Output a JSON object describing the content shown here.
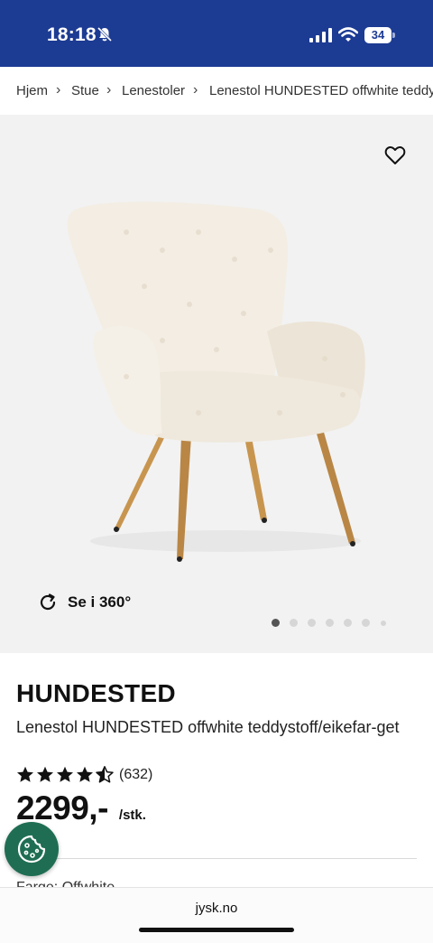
{
  "status_bar": {
    "time": "18:18",
    "battery": "34",
    "icons": [
      "bell-slash-icon",
      "signal-icon",
      "wifi-icon",
      "battery-icon"
    ]
  },
  "breadcrumb": {
    "items": [
      "Hjem",
      "Stue",
      "Lenestoler",
      "Lenestol HUNDESTED offwhite teddystoff/eikefarget"
    ],
    "separator": "›"
  },
  "gallery": {
    "view_360_label": "Se i 360°",
    "favorite_icon": "heart-icon",
    "image_count": 7,
    "active_image_index": 0
  },
  "product": {
    "brand": "HUNDESTED",
    "title": "Lenestol HUNDESTED offwhite teddystoff/eikefar-get",
    "rating_value": 4.5,
    "rating_count": "(632)",
    "price": "2299,-",
    "unit": "/stk."
  },
  "below_fold": {
    "partial_text": "Farge: Offwhite"
  },
  "cookie_button": {
    "icon": "cookie-icon"
  },
  "browser": {
    "url": "jysk.no"
  },
  "colors": {
    "header_blue": "#1c3b93",
    "cookie_green": "#1f6e53",
    "gallery_bg": "#f2f2f2"
  }
}
